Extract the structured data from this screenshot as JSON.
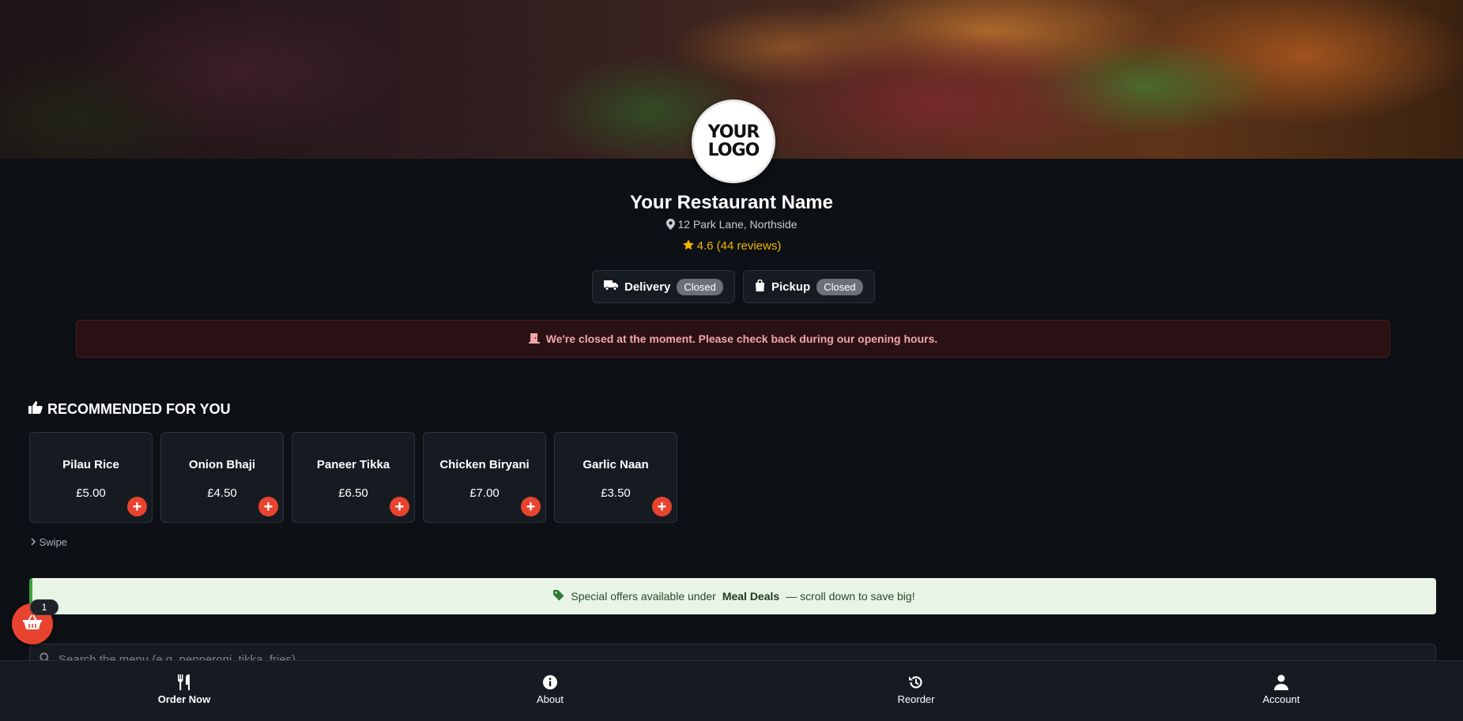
{
  "logo": {
    "line1": "YOUR",
    "line2": "LOGO"
  },
  "restaurant": {
    "name": "Your Restaurant Name",
    "address": "12 Park Lane, Northside",
    "rating": "4.6 (44 reviews)"
  },
  "services": [
    {
      "label": "Delivery",
      "status": "Closed",
      "icon": "truck-icon"
    },
    {
      "label": "Pickup",
      "status": "Closed",
      "icon": "shopping-bag-icon"
    }
  ],
  "alert": {
    "text": "We're closed at the moment. Please check back during our opening hours.",
    "icon": "closed-door-icon"
  },
  "recommended": {
    "heading": "RECOMMENDED FOR YOU",
    "icon": "thumbs-up-icon",
    "items": [
      {
        "name": "Pilau Rice",
        "price": "£5.00"
      },
      {
        "name": "Onion Bhaji",
        "price": "£4.50"
      },
      {
        "name": "Paneer Tikka",
        "price": "£6.50"
      },
      {
        "name": "Chicken Biryani",
        "price": "£7.00"
      },
      {
        "name": "Garlic Naan",
        "price": "£3.50"
      }
    ],
    "add_symbol": "+",
    "swipe_label": "Swipe"
  },
  "offer": {
    "before": "Special offers available under",
    "highlight": "Meal Deals",
    "after": "— scroll down to save big!",
    "icon": "tag-icon"
  },
  "search": {
    "placeholder": "Search the menu (e.g. pepperoni, tikka, fries)",
    "value": ""
  },
  "cart": {
    "count": "1",
    "icon": "basket-icon"
  },
  "nav": [
    {
      "label": "Order Now",
      "icon": "utensils-icon",
      "active": true
    },
    {
      "label": "About",
      "icon": "info-icon",
      "active": false
    },
    {
      "label": "Reorder",
      "icon": "history-icon",
      "active": false
    },
    {
      "label": "Account",
      "icon": "user-icon",
      "active": false
    }
  ],
  "colors": {
    "background": "#0d1014",
    "accent": "#e8432e",
    "rating": "#f4b400",
    "badge": "#6b7079",
    "alert_text": "#f1a6ab",
    "offer_bg": "#e7f4e6"
  }
}
